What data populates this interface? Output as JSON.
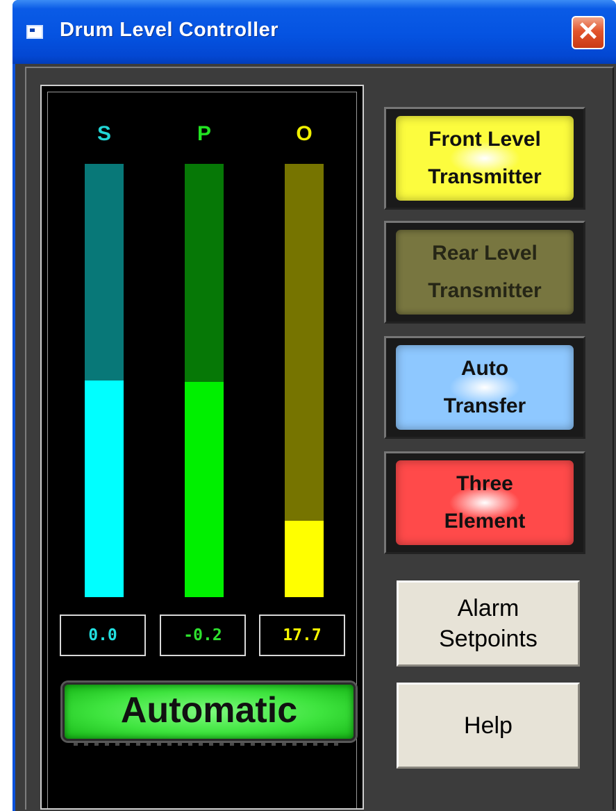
{
  "window": {
    "title": "Drum Level Controller"
  },
  "bars": [
    {
      "label": "S",
      "value": "0.0",
      "fill_fraction": 0.5,
      "label_color": "#22d6d6",
      "track_color": "#087878",
      "fill_color": "#00ffff",
      "value_color": "#22e0e0"
    },
    {
      "label": "P",
      "value": "-0.2",
      "fill_fraction": 0.497,
      "label_color": "#22e422",
      "track_color": "#067806",
      "fill_color": "#00f000",
      "value_color": "#2ee02e"
    },
    {
      "label": "O",
      "value": "17.7",
      "fill_fraction": 0.177,
      "label_color": "#f0f000",
      "track_color": "#767400",
      "fill_color": "#ffff00",
      "value_color": "#f8f800"
    }
  ],
  "mode": {
    "label": "Automatic",
    "color": "#3ee43e"
  },
  "buttons": {
    "front_level": {
      "line1": "Front Level",
      "line2": "Transmitter",
      "color": "#fcfc3e",
      "active": true
    },
    "rear_level": {
      "line1": "Rear Level",
      "line2": "Transmitter",
      "color": "#787640",
      "active": false
    },
    "auto_transfer": {
      "line1": "Auto",
      "line2": "Transfer",
      "color": "#8ec8ff",
      "active": true
    },
    "three_element": {
      "line1": "Three",
      "line2": "Element",
      "color": "#ff4a4a",
      "active": true
    },
    "alarm_setpoints": {
      "line1": "Alarm",
      "line2": "Setpoints"
    },
    "help": {
      "label": "Help"
    }
  }
}
